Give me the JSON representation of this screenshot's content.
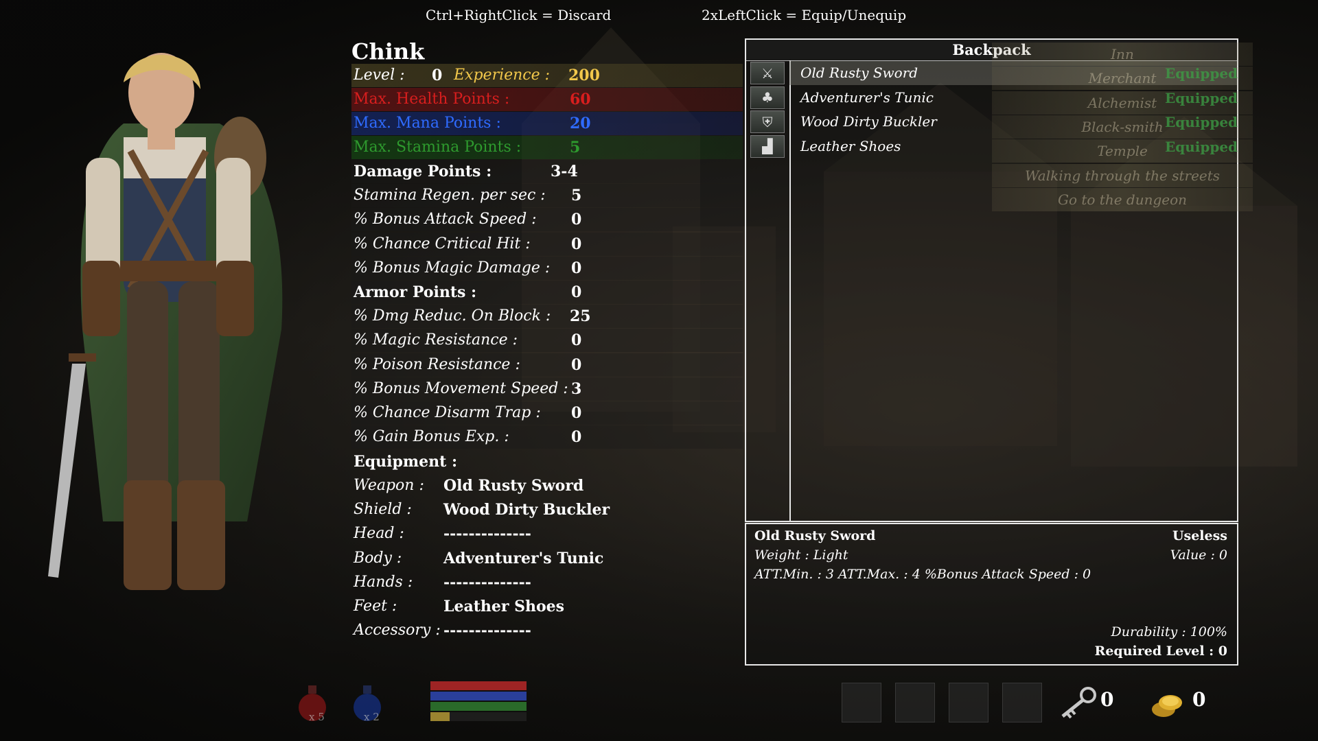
{
  "hints": {
    "discard": "Ctrl+RightClick = Discard",
    "equip": "2xLeftClick = Equip/Unequip"
  },
  "character": {
    "name": "Chink",
    "level_label": "Level :",
    "level": "0",
    "exp_label": "Experience :",
    "exp": "200",
    "hp_label": "Max. Health Points :",
    "hp": "60",
    "mp_label": "Max. Mana Points :",
    "mp": "20",
    "sp_label": "Max. Stamina Points :",
    "sp": "5"
  },
  "stats": [
    {
      "label": "Damage Points :",
      "value": "3-4"
    },
    {
      "label": "Stamina Regen. per sec :",
      "value": "5"
    },
    {
      "label": "% Bonus Attack Speed :",
      "value": "0"
    },
    {
      "label": "% Chance Critical Hit :",
      "value": "0"
    },
    {
      "label": "% Bonus Magic Damage :",
      "value": "0"
    },
    {
      "label": "Armor Points :",
      "value": "0"
    },
    {
      "label": "% Dmg Reduc. On Block :",
      "value": "25"
    },
    {
      "label": "% Magic Resistance :",
      "value": "0"
    },
    {
      "label": "% Poison Resistance :",
      "value": "0"
    },
    {
      "label": "% Bonus Movement Speed :",
      "value": "3"
    },
    {
      "label": "% Chance Disarm Trap :",
      "value": "0"
    },
    {
      "label": "% Gain Bonus Exp. :",
      "value": "0"
    }
  ],
  "equipment": {
    "title": "Equipment :",
    "slots": [
      {
        "label": "Weapon :",
        "value": "Old Rusty Sword"
      },
      {
        "label": "Shield :",
        "value": "Wood Dirty Buckler"
      },
      {
        "label": "Head :",
        "value": "--------------"
      },
      {
        "label": "Body :",
        "value": "Adventurer's Tunic"
      },
      {
        "label": "Hands :",
        "value": "--------------"
      },
      {
        "label": "Feet :",
        "value": "Leather Shoes"
      },
      {
        "label": "Accessory :",
        "value": "--------------"
      }
    ]
  },
  "backpack": {
    "title": "Backpack",
    "items": [
      {
        "name": "Old Rusty Sword",
        "icon": "sword-icon",
        "glyph": "⚔"
      },
      {
        "name": "Adventurer's Tunic",
        "icon": "tunic-icon",
        "glyph": "♣"
      },
      {
        "name": "Wood Dirty Buckler",
        "icon": "shield-icon",
        "glyph": "⛨"
      },
      {
        "name": "Leather Shoes",
        "icon": "boot-icon",
        "glyph": "▟"
      }
    ],
    "equipped_label": "Equipped"
  },
  "town_menu": [
    "Inn",
    "Merchant",
    "Alchemist",
    "Black-smith",
    "Temple",
    "Walking through the streets",
    "Go to the dungeon"
  ],
  "details": {
    "name": "Old Rusty Sword",
    "quality": "Useless",
    "weight": "Weight :  Light",
    "value": "Value : 0",
    "att": "ATT.Min. :   3   ATT.Max. :   4   %Bonus Attack Speed :   0",
    "durability": "Durability : 100%",
    "required": "Required Level : 0"
  },
  "bottom": {
    "health_potions": "x 5",
    "mana_potions": "x 2",
    "bars": {
      "health": 1.0,
      "mana": 1.0,
      "stamina": 1.0,
      "experience": 0.2
    },
    "keys": "0",
    "gold": "0"
  },
  "colors": {
    "level": "#ffffff",
    "experience": "#f2c84b",
    "health": "#d81e1e",
    "mana": "#2f6bff",
    "stamina": "#2e9a2e",
    "equipped": "#3ca046"
  }
}
